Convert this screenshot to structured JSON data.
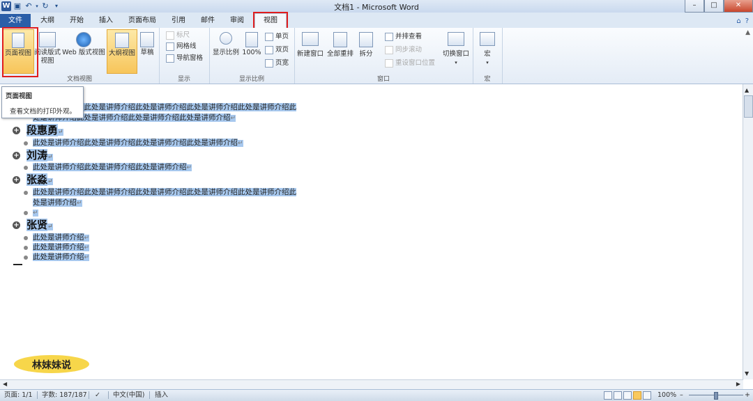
{
  "window": {
    "title": "文档1 - Microsoft Word",
    "min": "–",
    "max": "□",
    "close": "✕",
    "app_letter": "W"
  },
  "tabs": {
    "file": "文件",
    "items": [
      "大纲",
      "开始",
      "插入",
      "页面布局",
      "引用",
      "邮件",
      "审阅",
      "视图"
    ],
    "active": "视图"
  },
  "ribbon": {
    "doc_views": {
      "label": "文档视图",
      "print_layout": "页面视图",
      "reading_l1": "阅读版式",
      "reading_l2": "视图",
      "web_layout": "Web 版式视图",
      "outline": "大纲视图",
      "draft": "草稿"
    },
    "show": {
      "label": "显示",
      "ruler": "标尺",
      "gridlines": "网格线",
      "nav_pane": "导航窗格"
    },
    "zoom": {
      "label": "显示比例",
      "zoom": "显示比例",
      "zoom_100": "100%",
      "one_page": "单页",
      "two_pages": "双页",
      "page_width": "页宽"
    },
    "window": {
      "label": "窗口",
      "new_window": "新建窗口",
      "arrange_all": "全部重排",
      "split": "拆分",
      "side_by_side": "并排查看",
      "sync_scroll": "同步滚动",
      "reset_pos": "重设窗口位置",
      "switch_windows": "切换窗口"
    },
    "macros": {
      "label": "宏",
      "macros": "宏"
    }
  },
  "tooltip": {
    "title": "页面视图",
    "desc": "查看文档的打印外观。"
  },
  "document": {
    "line1": "此处是讲师介绍此处是讲师介绍此处是讲师介绍此处是讲师介绍此处是讲师介绍此",
    "line2": "处是讲师介绍此处是讲师介绍此处是讲师介绍此处是讲师介绍",
    "h1": "段惠勇",
    "h1_body": "此处是讲师介绍此处是讲师介绍此处是讲师介绍此处是讲师介绍",
    "h2": "刘涛",
    "h2_body": "此处是讲师介绍此处是讲师介绍此处是讲师介绍",
    "h3": "张淼",
    "h3_body1": "此处是讲师介绍此处是讲师介绍此处是讲师介绍此处是讲师介绍此处是讲师介绍此",
    "h3_body2": "处是讲师介绍",
    "h4": "张贤",
    "h4_body1": "此处是讲师介绍",
    "h4_body2": "此处是讲师介绍",
    "h4_body3": "此处是讲师介绍",
    "pilcrow": "↵"
  },
  "watermark": "林妹妹说",
  "status": {
    "page": "页面: 1/1",
    "words": "字数: 187/187",
    "language": "中文(中国)",
    "mode": "插入",
    "zoom": "100%",
    "zoom_minus": "–",
    "zoom_plus": "+"
  }
}
